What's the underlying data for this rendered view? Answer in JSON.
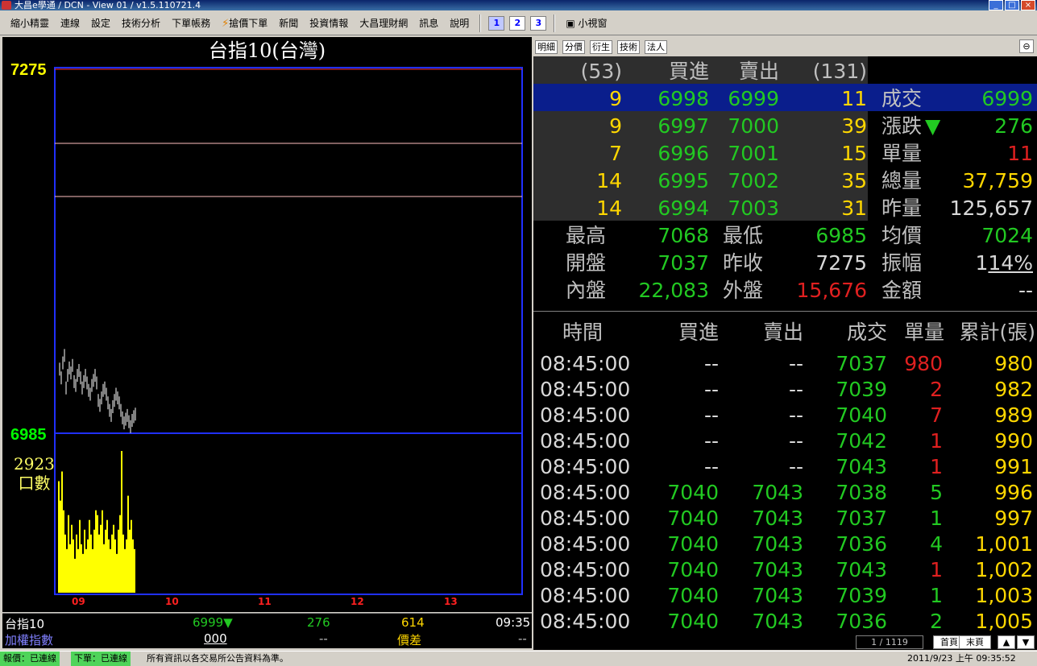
{
  "window": {
    "title": "大昌e學通 / DCN - View 01 / v1.5.110721.4"
  },
  "menu": {
    "items": [
      "縮小精靈",
      "連線",
      "設定",
      "技術分析",
      "下單帳務",
      "搶價下單",
      "新聞",
      "投資情報",
      "大昌理財網",
      "訊息",
      "說明"
    ],
    "layout_buttons": [
      "1",
      "2",
      "3"
    ],
    "mini_window": "小視窗"
  },
  "chart": {
    "title": "台指10(台灣)",
    "high_label": "7275",
    "low_label": "6985",
    "vol_value": "2923",
    "vol_unit": "口數",
    "time_labels": [
      "09",
      "10",
      "11",
      "12",
      "13"
    ]
  },
  "chart_data": {
    "type": "line",
    "price": {
      "ylim": [
        6985,
        7275
      ],
      "values": [
        7035,
        7028,
        7040,
        7046,
        7020,
        7030,
        7036,
        7032,
        7038,
        7025,
        7022,
        7030,
        7034,
        7028,
        7020,
        7025,
        7030,
        7024,
        7018,
        7015,
        7022,
        7026,
        7030,
        7024,
        7010,
        7006,
        7012,
        7018,
        7020,
        7015,
        7008,
        7002,
        6998,
        7005,
        7010,
        7015,
        7012,
        7008,
        7002,
        6996,
        6992,
        6995,
        6998,
        6993,
        6989,
        6994,
        6997,
        6999
      ]
    },
    "volume": {
      "ylim": [
        0,
        2923
      ],
      "values": [
        2300,
        1900,
        2500,
        1700,
        1200,
        900,
        1600,
        1000,
        1400,
        1100,
        700,
        1200,
        900,
        1500,
        1000,
        800,
        1300,
        900,
        1100,
        1500,
        1200,
        900,
        1300,
        1700,
        1600,
        1200,
        1400,
        1700,
        1000,
        1300,
        1500,
        1100,
        900,
        1200,
        1400,
        1100,
        800,
        1300,
        1600,
        2923,
        1200,
        900,
        1100,
        2000,
        1300,
        1500,
        1100,
        900
      ]
    },
    "x_ticks": [
      "09",
      "10",
      "11",
      "12",
      "13"
    ]
  },
  "infobar": {
    "symbol": "台指10",
    "price": "6999",
    "change": "276",
    "spread": "614",
    "time": "09:35",
    "index_label": "加權指數",
    "index_value": "000",
    "dash1": "--",
    "diff_label": "價差",
    "dash2": "--"
  },
  "tabs": [
    "明細",
    "分價",
    "衍生",
    "技術",
    "法人"
  ],
  "book": {
    "headers": {
      "bid_count": "(53)",
      "bid": "買進",
      "ask": "賣出",
      "ask_count": "(131)"
    },
    "rows": [
      {
        "bq": "9",
        "bid": "6998",
        "ask": "6999",
        "aq": "11",
        "label": "成交",
        "value": "6999"
      },
      {
        "bq": "9",
        "bid": "6997",
        "ask": "7000",
        "aq": "39",
        "label": "漲跌",
        "value": "276"
      },
      {
        "bq": "7",
        "bid": "6996",
        "ask": "7001",
        "aq": "15",
        "label": "單量",
        "value": "11"
      },
      {
        "bq": "14",
        "bid": "6995",
        "ask": "7002",
        "aq": "35",
        "label": "總量",
        "value": "37,759"
      },
      {
        "bq": "14",
        "bid": "6994",
        "ask": "7003",
        "aq": "31",
        "label": "昨量",
        "value": "125,657"
      }
    ]
  },
  "stats": {
    "high_label": "最高",
    "high": "7068",
    "low_label": "最低",
    "low": "6985",
    "avg_label": "均價",
    "avg": "7024",
    "open_label": "開盤",
    "open": "7037",
    "prev_label": "昨收",
    "prev": "7275",
    "amp_label": "振幅",
    "amp": "1",
    "amp2": "14%",
    "inner_label": "內盤",
    "inner": "22,083",
    "outer_label": "外盤",
    "outer": "15,676",
    "amount_label": "金額",
    "amount": "--"
  },
  "ticks": {
    "headers": {
      "time": "時間",
      "bid": "買進",
      "ask": "賣出",
      "price": "成交",
      "qty": "單量",
      "cum": "累計(張)"
    },
    "rows": [
      {
        "time": "08:45:00",
        "bid": "--",
        "ask": "--",
        "price": "7037",
        "qty": "980",
        "cum": "980",
        "qcolor": "#e02020"
      },
      {
        "time": "08:45:00",
        "bid": "--",
        "ask": "--",
        "price": "7039",
        "qty": "2",
        "cum": "982",
        "qcolor": "#e02020"
      },
      {
        "time": "08:45:00",
        "bid": "--",
        "ask": "--",
        "price": "7040",
        "qty": "7",
        "cum": "989",
        "qcolor": "#e02020"
      },
      {
        "time": "08:45:00",
        "bid": "--",
        "ask": "--",
        "price": "7042",
        "qty": "1",
        "cum": "990",
        "qcolor": "#e02020"
      },
      {
        "time": "08:45:00",
        "bid": "--",
        "ask": "--",
        "price": "7043",
        "qty": "1",
        "cum": "991",
        "qcolor": "#e02020"
      },
      {
        "time": "08:45:00",
        "bid": "7040",
        "ask": "7043",
        "price": "7038",
        "qty": "5",
        "cum": "996",
        "qcolor": "#22c922"
      },
      {
        "time": "08:45:00",
        "bid": "7040",
        "ask": "7043",
        "price": "7037",
        "qty": "1",
        "cum": "997",
        "qcolor": "#22c922"
      },
      {
        "time": "08:45:00",
        "bid": "7040",
        "ask": "7043",
        "price": "7036",
        "qty": "4",
        "cum": "1,001",
        "qcolor": "#22c922"
      },
      {
        "time": "08:45:00",
        "bid": "7040",
        "ask": "7043",
        "price": "7043",
        "qty": "1",
        "cum": "1,002",
        "qcolor": "#e02020"
      },
      {
        "time": "08:45:00",
        "bid": "7040",
        "ask": "7043",
        "price": "7039",
        "qty": "1",
        "cum": "1,003",
        "qcolor": "#22c922"
      },
      {
        "time": "08:45:00",
        "bid": "7040",
        "ask": "7043",
        "price": "7036",
        "qty": "2",
        "cum": "1,005",
        "qcolor": "#22c922"
      }
    ]
  },
  "pager": {
    "page": "1 / 1119",
    "first": "首頁",
    "last": "末頁"
  },
  "status": {
    "quote": "報價：已連線",
    "order": "下單：已連線",
    "note": "所有資訊以各交易所公告資料為準。",
    "datetime": "2011/9/23 上午 09:35:52"
  }
}
